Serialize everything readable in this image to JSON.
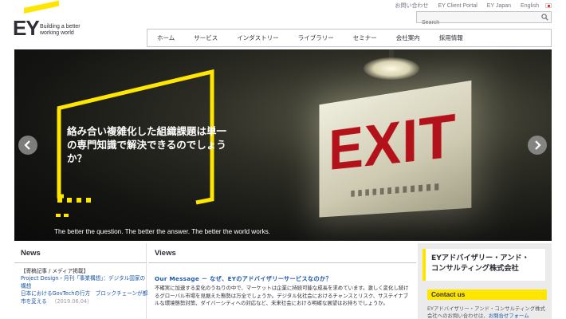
{
  "header": {
    "logo_mark": "EY",
    "logo_tagline_line1": "Building a better",
    "logo_tagline_line2": "working world",
    "utility_links": [
      "お問い合わせ",
      "EY Client Portal",
      "EY Japan",
      "English"
    ],
    "search_placeholder": "Search"
  },
  "nav": {
    "items": [
      "ホーム",
      "サービス",
      "インダストリー",
      "ライブラリー",
      "セミナー",
      "会社案内",
      "採用情報"
    ]
  },
  "hero": {
    "headline": "絡み合い複雑化した組織課題は単一の専門知識で解決できるのでしょうか？",
    "tagline": "The better the question. The better the answer. The better the world works.",
    "sign_text": "EXIT",
    "slide_count": 3,
    "active_slide": 1
  },
  "news": {
    "title": "News",
    "category": "【寄稿記事 / メディア掲載】",
    "item1": "Project Design・月刊「事業構想」：デジタル国家の構想",
    "item2": "日本におけるGovTechの行方　ブロックチェーンが都市を変える",
    "date": "（2019.06.04）"
  },
  "views": {
    "title": "Views",
    "heading": "Our Message － なぜ、EYのアドバイザリーサービスなのか？",
    "body": "不確実に加速する変化のうねりの中で、マーケットは企業に持続可能な成長を求めています。激しく変化し続けるグローバル市場を見据えた態勢は万全でしょうか。デジタル化社会におけるチャンスとリスク、サステイナブルな環境態勢対策、ダイバーシティへの対応など、未来社会における明確な展望はお持ちでしょうか。"
  },
  "side": {
    "company_line1": "EYアドバイザリー・アンド・",
    "company_line2": "コンサルティング株式会社",
    "contact_title": "Contact us",
    "contact_text": "EYアドバイザリー・アンド・コンサルティング株式会社へのお問い合わせは、",
    "contact_link": "お問合せフォーム"
  },
  "colors": {
    "brand_yellow": "#ffe600",
    "brand_dark": "#2e2e38",
    "link_blue": "#1a56a8"
  }
}
